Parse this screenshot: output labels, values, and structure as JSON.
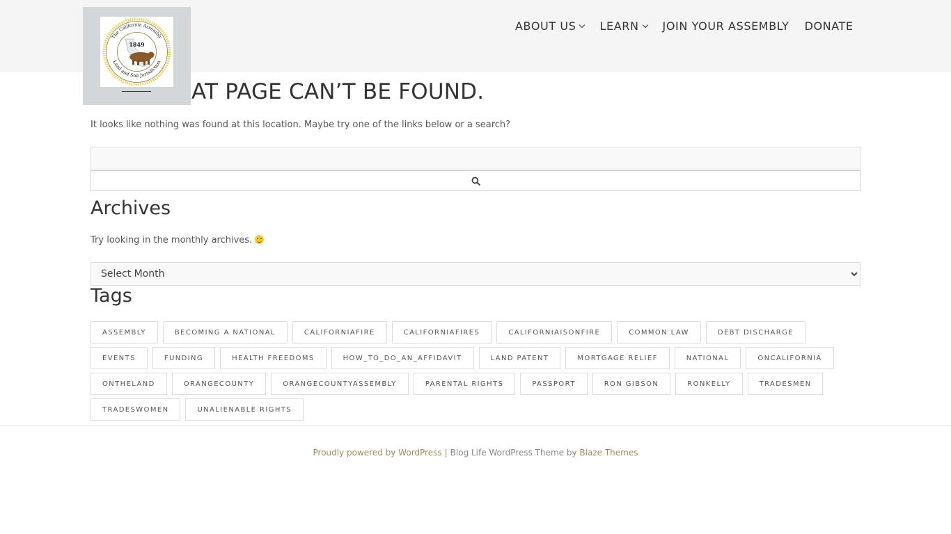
{
  "header": {
    "logo": {
      "seal_top_text": "The California Assembly",
      "seal_year": "1849",
      "seal_bottom_text": "Land and Soil Jurisdiction",
      "ring_color": "#e8d35a"
    },
    "nav": [
      {
        "label": "ABOUT US",
        "has_dropdown": true,
        "icon": "chevron-down-icon"
      },
      {
        "label": "LEARN",
        "has_dropdown": true,
        "icon": "chevron-down-icon"
      },
      {
        "label": "JOIN YOUR ASSEMBLY",
        "has_dropdown": false
      },
      {
        "label": "DONATE",
        "has_dropdown": false
      }
    ]
  },
  "main": {
    "title": "AT PAGE CAN’T BE FOUND.",
    "message": "It looks like nothing was found at this location. Maybe try one of the links below or a search?",
    "search": {
      "value": "",
      "placeholder": "",
      "button_icon": "search-icon"
    },
    "archives": {
      "heading": "Archives",
      "text": "Try looking in the monthly archives.",
      "emoji": "slightly-smiling-face-icon",
      "select_value": "Select Month"
    },
    "tags": {
      "heading": "Tags",
      "items": [
        "ASSEMBLY",
        "BECOMING A NATIONAL",
        "CALIFORNIAFIRE",
        "CALIFORNIAFIRES",
        "CALIFORNIAISONFIRE",
        "COMMON LAW",
        "DEBT DISCHARGE",
        "EVENTS",
        "FUNDING",
        "HEALTH FREEDOMS",
        "HOW_TO_DO_AN_AFFIDAVIT",
        "LAND PATENT",
        "MORTGAGE RELIEF",
        "NATIONAL",
        "ONCALIFORNIA",
        "ONTHELAND",
        "ORANGECOUNTY",
        "ORANGECOUNTYASSEMBLY",
        "PARENTAL RIGHTS",
        "PASSPORT",
        "RON GIBSON",
        "RONKELLY",
        "TRADESMEN",
        "TRADESWOMEN",
        "UNALIENABLE RIGHTS"
      ]
    }
  },
  "footer": {
    "powered_link": "Proudly powered by WordPress",
    "separator": "|",
    "theme_text": "Blog Life WordPress Theme by ",
    "theme_link": "Blaze Themes",
    "link_color": "#a08a5c"
  }
}
